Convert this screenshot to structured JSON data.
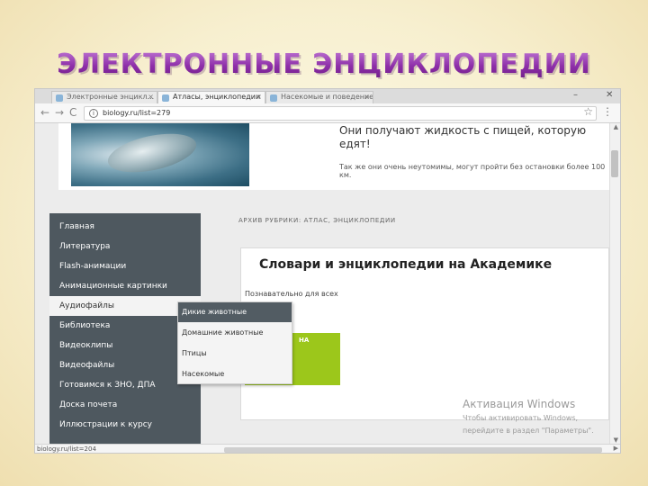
{
  "slide": {
    "title": "ЭЛЕКТРОННЫЕ ЭНЦИКЛОПЕДИИ"
  },
  "browser": {
    "tabs": [
      {
        "label": "Электронные энцикл...",
        "active": false
      },
      {
        "label": "Атласы, энциклопедии",
        "active": true
      },
      {
        "label": "Насекомые и поведение",
        "active": false
      }
    ],
    "window_controls": {
      "minimize": "–",
      "close": "✕"
    },
    "nav": {
      "back": "←",
      "forward": "→",
      "reload": "C"
    },
    "url": "biology.ru/list=279",
    "status_text": "biology.ru/list=204"
  },
  "top_card": {
    "text_main": "Они получают жидкость с пищей, которую едят!",
    "text_small": "Так же они очень неутомимы, могут пройти без остановки более 100 км."
  },
  "breadcrumb": "АРХИВ РУБРИКИ: АТЛАС, ЭНЦИКЛОПЕДИИ",
  "sidebar": {
    "items": [
      {
        "label": "Главная",
        "highlighted": false
      },
      {
        "label": "Литература",
        "highlighted": false
      },
      {
        "label": "Flash-анимации",
        "highlighted": false
      },
      {
        "label": "Анимационные картинки",
        "highlighted": false
      },
      {
        "label": "Аудиофайлы",
        "highlighted": true
      },
      {
        "label": "Библиотека",
        "highlighted": false
      },
      {
        "label": "Видеоклипы",
        "highlighted": false
      },
      {
        "label": "Видеофайлы",
        "highlighted": false
      },
      {
        "label": "Готовимся к ЗНО, ДПА",
        "highlighted": false
      },
      {
        "label": "Доска почета",
        "highlighted": false
      },
      {
        "label": "Иллюстрации к курсу",
        "highlighted": false
      }
    ]
  },
  "submenu": {
    "items": [
      {
        "label": "Дикие животные",
        "highlighted": true
      },
      {
        "label": "Домашние животные",
        "highlighted": false
      },
      {
        "label": "Птицы",
        "highlighted": false
      },
      {
        "label": "Насекомые",
        "highlighted": false
      }
    ]
  },
  "content": {
    "title": "Словари и энциклопедии на Академике",
    "subtitle": "Познавательно для всех",
    "green_label": "НА"
  },
  "watermark": {
    "line1": "Активация Windows",
    "line2": "Чтобы активировать Windows,",
    "line3": "перейдите в раздел \"Параметры\"."
  },
  "colors": {
    "title_purple": "#8e2fa9",
    "sidebar_bg": "#4e585f",
    "green_block": "#9cc71b"
  }
}
